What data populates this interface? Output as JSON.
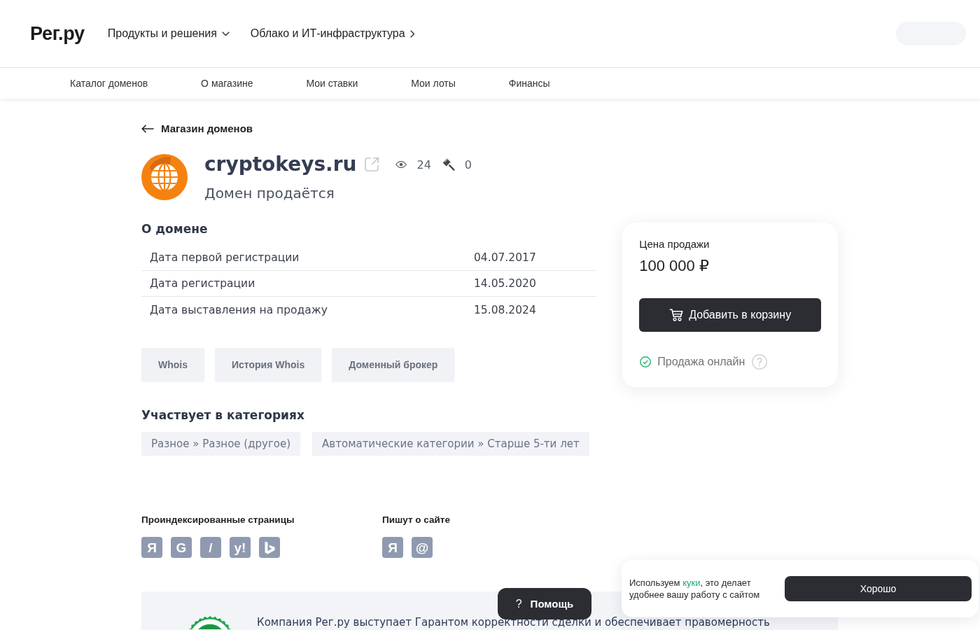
{
  "header": {
    "logo": "Рег.ру",
    "menu": [
      {
        "label": "Продукты и решения",
        "kind": "dropdown"
      },
      {
        "label": "Облако и ИТ-инфраструктура",
        "kind": "link"
      }
    ]
  },
  "subnav": [
    {
      "label": "Каталог доменов"
    },
    {
      "label": "О магазине"
    },
    {
      "label": "Мои ставки"
    },
    {
      "label": "Мои лоты"
    },
    {
      "label": "Финансы"
    }
  ],
  "back_link": {
    "label": "Магазин доменов"
  },
  "domain": {
    "name": "cryptokeys.ru",
    "status": "Домен продаётся",
    "stats": [
      {
        "kind": "views",
        "value": "24"
      },
      {
        "kind": "bids",
        "value": "0"
      }
    ]
  },
  "about": {
    "title": "О домене",
    "rows": [
      {
        "label": "Дата первой регистрации",
        "value": "04.07.2017"
      },
      {
        "label": "Дата регистрации",
        "value": "14.05.2020"
      },
      {
        "label": "Дата выставления на продажу",
        "value": "15.08.2024"
      }
    ]
  },
  "tools": [
    {
      "label": "Whois"
    },
    {
      "label": "История Whois"
    },
    {
      "label": "Доменный брокер"
    }
  ],
  "categories": {
    "title": "Участвует в категориях",
    "tags": [
      "Разное » Разное (другое)",
      "Автоматические категории » Старше 5-ти лет"
    ]
  },
  "indexed_pages": {
    "title": "Проиндексированные страницы",
    "sources": [
      {
        "kind": "letter",
        "glyph": "Я"
      },
      {
        "kind": "letter",
        "glyph": "G"
      },
      {
        "kind": "letter",
        "glyph": "/"
      },
      {
        "kind": "letter",
        "glyph": "y!"
      },
      {
        "kind": "shape"
      }
    ]
  },
  "mentions": {
    "title": "Пишут о сайте",
    "sources": [
      {
        "kind": "letter",
        "glyph": "Я"
      },
      {
        "kind": "letter",
        "glyph": "@"
      }
    ]
  },
  "price_card": {
    "label": "Цена продажи",
    "price": "100 000 ₽",
    "button": "Добавить в корзину",
    "sale_mode": "Продажа онлайн"
  },
  "guarantee": {
    "text": "Компания Рег.ру выступает Гарантом корректности сделки и обеспечивает правомерность"
  },
  "help_button": {
    "icon": "?",
    "label": "Помощь"
  },
  "cookie_banner": {
    "parts": [
      {
        "kind": "text",
        "text": "Используем "
      },
      {
        "kind": "link",
        "text": "куки"
      },
      {
        "kind": "text",
        "text": ", это делает удобнее вашу работу с сайтом"
      }
    ],
    "button": "Хорошо"
  }
}
